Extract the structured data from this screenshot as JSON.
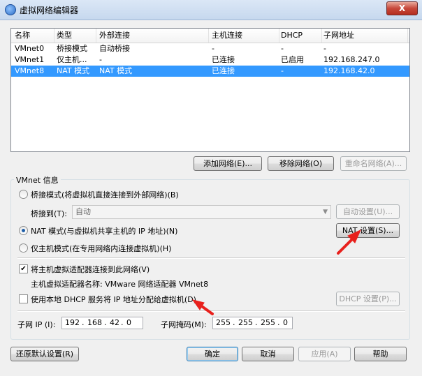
{
  "window": {
    "title": "虚拟网络编辑器",
    "close_glyph": "X"
  },
  "table": {
    "headers": [
      "名称",
      "类型",
      "外部连接",
      "主机连接",
      "DHCP",
      "子网地址"
    ],
    "rows": [
      [
        "VMnet0",
        "桥接模式",
        "自动桥接",
        "-",
        "-",
        "-"
      ],
      [
        "VMnet1",
        "仅主机...",
        "-",
        "已连接",
        "已启用",
        "192.168.247.0"
      ],
      [
        "VMnet8",
        "NAT 模式",
        "NAT 模式",
        "已连接",
        "-",
        "192.168.42.0"
      ]
    ],
    "selected_row": 2
  },
  "network_buttons": {
    "add": "添加网络(E)...",
    "remove": "移除网络(O)",
    "rename": "重命名网络(A)..."
  },
  "vmnet_info": {
    "title": "VMnet 信息",
    "bridge_radio": "桥接模式(将虚拟机直接连接到外部网络)(B)",
    "bridge_to_label": "桥接到(T):",
    "bridge_to_value": "自动",
    "auto_settings": "自动设置(U)...",
    "nat_radio": "NAT 模式(与虚拟机共享主机的 IP 地址)(N)",
    "nat_settings": "NAT 设置(S)...",
    "host_only_radio": "仅主机模式(在专用网络内连接虚拟机)(H)",
    "connect_adapter_check": "将主机虚拟适配器连接到此网络(V)",
    "adapter_name": "主机虚拟适配器名称: VMware 网络适配器 VMnet8",
    "dhcp_check": "使用本地 DHCP 服务将 IP 地址分配给虚拟机(D)",
    "dhcp_settings": "DHCP 设置(P)...",
    "subnet_ip_label": "子网 IP (I):",
    "subnet_ip": [
      "192",
      "168",
      "42",
      "0"
    ],
    "subnet_mask_label": "子网掩码(M):",
    "subnet_mask": [
      "255",
      "255",
      "255",
      "0"
    ]
  },
  "bottom_buttons": {
    "restore": "还原默认设置(R)",
    "ok": "确定",
    "cancel": "取消",
    "apply": "应用(A)",
    "help": "帮助"
  },
  "colors": {
    "selection": "#3399ff",
    "annotation_arrow": "#e8201c"
  }
}
